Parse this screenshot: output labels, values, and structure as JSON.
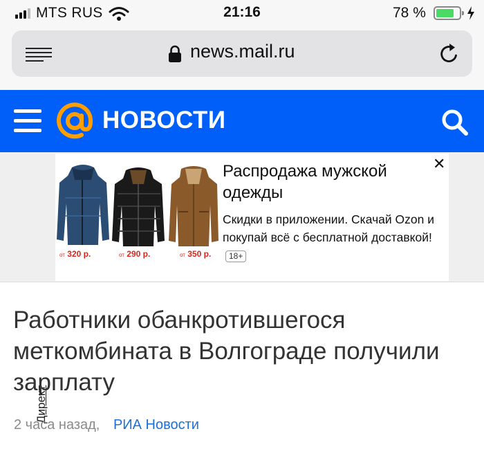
{
  "status_bar": {
    "carrier": "MTS RUS",
    "time": "21:16",
    "battery_percent": "78 %",
    "battery_level": 0.78,
    "battery_color": "#4cd964",
    "icons": [
      "signal-icon",
      "wifi-icon",
      "battery-icon",
      "charging-icon"
    ]
  },
  "browser": {
    "url": "news.mail.ru",
    "icons": [
      "reader-view-icon",
      "lock-icon",
      "reload-icon"
    ]
  },
  "site_header": {
    "logo_text": "НОВОСТИ",
    "background_color": "#005ff9",
    "logo_color": "#ff9e00",
    "icons": [
      "menu-icon",
      "at-logo-icon",
      "search-icon"
    ]
  },
  "ad": {
    "label": "Директ",
    "title": "Распродажа мужской одежды",
    "description": "Скидки в приложении. Скачай Ozon и покупай всё с бесплатной доставкой!",
    "age_badge": "18+",
    "close": "✕",
    "products": [
      {
        "prefix": "от",
        "price": "320 р."
      },
      {
        "prefix": "от",
        "price": "290 р."
      },
      {
        "prefix": "от",
        "price": "350 р."
      }
    ]
  },
  "article": {
    "headline": "Работники обанкротившегося меткомбината в Волгограде получили зарплату",
    "time": "2 часа назад,",
    "source": "РИА Новости",
    "source_color": "#1c6fd6"
  }
}
